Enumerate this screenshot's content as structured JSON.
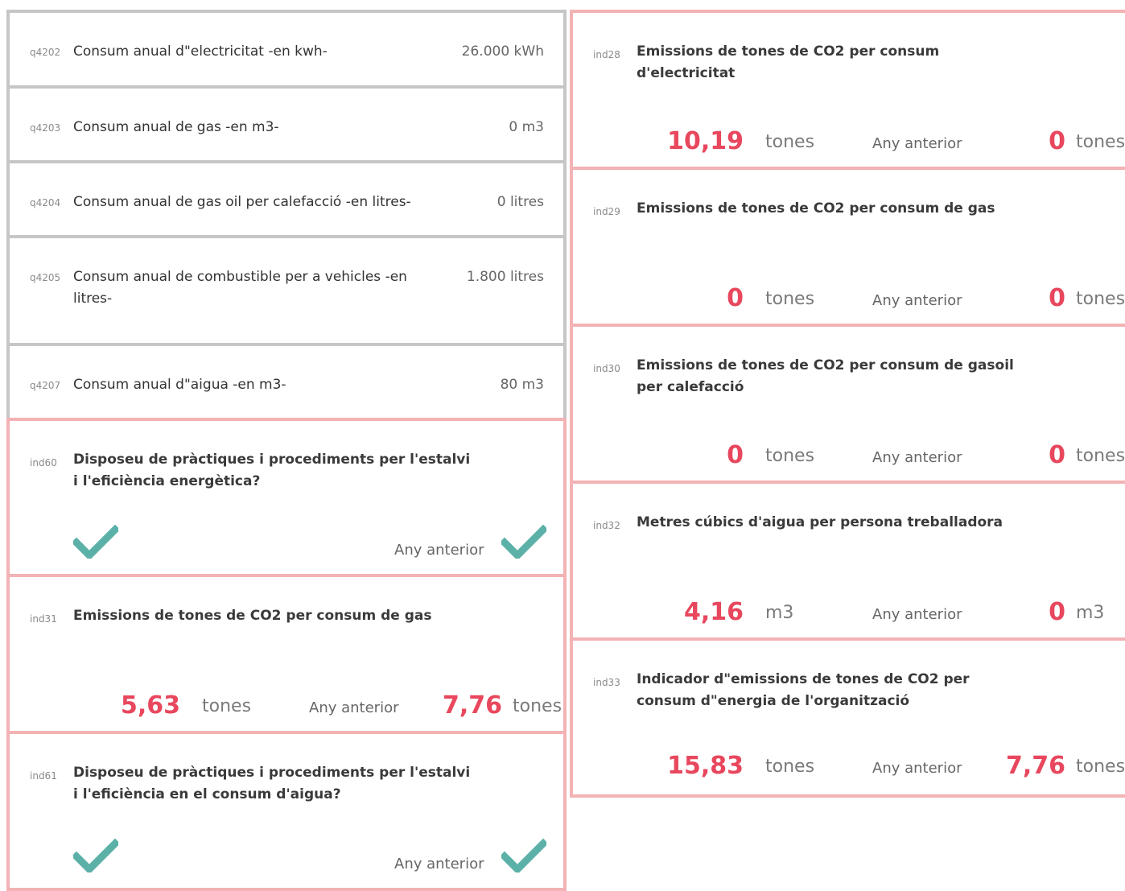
{
  "colors": {
    "accent": "#e8475d",
    "check": "#5bb1a8",
    "border_input": "#c6c6c6",
    "border_indicator": "#f3b2b4"
  },
  "inputs": [
    {
      "code": "q4202",
      "label": "Consum anual d\"electricitat -en kwh-",
      "value": "26.000 kWh"
    },
    {
      "code": "q4203",
      "label": "Consum anual de gas -en m3-",
      "value": "0 m3"
    },
    {
      "code": "q4204",
      "label": "Consum anual de gas oil per calefacció -en litres-",
      "value": "0 litres"
    },
    {
      "code": "q4205",
      "label": "Consum anual de combustible per a vehicles -en litres-",
      "value": "1.800 litres"
    },
    {
      "code": "q4207",
      "label": "Consum anual d\"aigua -en m3-",
      "value": "80 m3"
    }
  ],
  "left_indicators": [
    {
      "code": "ind60",
      "title": "Disposeu de pràctiques i procediments per l'estalvi i l'eficiència energètica?",
      "icon": "check-icon",
      "prev_label": "Any anterior",
      "prev_icon": "check-icon"
    },
    {
      "code": "ind31",
      "title": "Emissions de tones de CO2 per consum de gas",
      "value": "5,63",
      "unit": "tones",
      "prev_label": "Any anterior",
      "prev_value": "7,76",
      "prev_unit": "tones"
    },
    {
      "code": "ind61",
      "title": "Disposeu de pràctiques i procediments per l'estalvi i l'eficiència en el consum d'aigua?",
      "icon": "check-icon",
      "prev_label": "Any anterior",
      "prev_icon": "check-icon"
    }
  ],
  "right_indicators": [
    {
      "code": "ind28",
      "title": "Emissions de tones de CO2 per consum d'electricitat",
      "value": "10,19",
      "unit": "tones",
      "prev_label": "Any anterior",
      "prev_value": "0",
      "prev_unit": "tones"
    },
    {
      "code": "ind29",
      "title": "Emissions de tones de CO2 per consum de gas",
      "value": "0",
      "unit": "tones",
      "prev_label": "Any anterior",
      "prev_value": "0",
      "prev_unit": "tones"
    },
    {
      "code": "ind30",
      "title": "Emissions de tones de CO2 per consum de gasoil per calefacció",
      "value": "0",
      "unit": "tones",
      "prev_label": "Any anterior",
      "prev_value": "0",
      "prev_unit": "tones"
    },
    {
      "code": "ind32",
      "title": "Metres cúbics d'aigua per persona treballadora",
      "value": "4,16",
      "unit": "m3",
      "prev_label": "Any anterior",
      "prev_value": "0",
      "prev_unit": "m3"
    },
    {
      "code": "ind33",
      "title": "Indicador d\"emissions de tones de CO2 per consum d\"energia de l'organització",
      "value": "15,83",
      "unit": "tones",
      "prev_label": "Any anterior",
      "prev_value": "7,76",
      "prev_unit": "tones"
    }
  ]
}
